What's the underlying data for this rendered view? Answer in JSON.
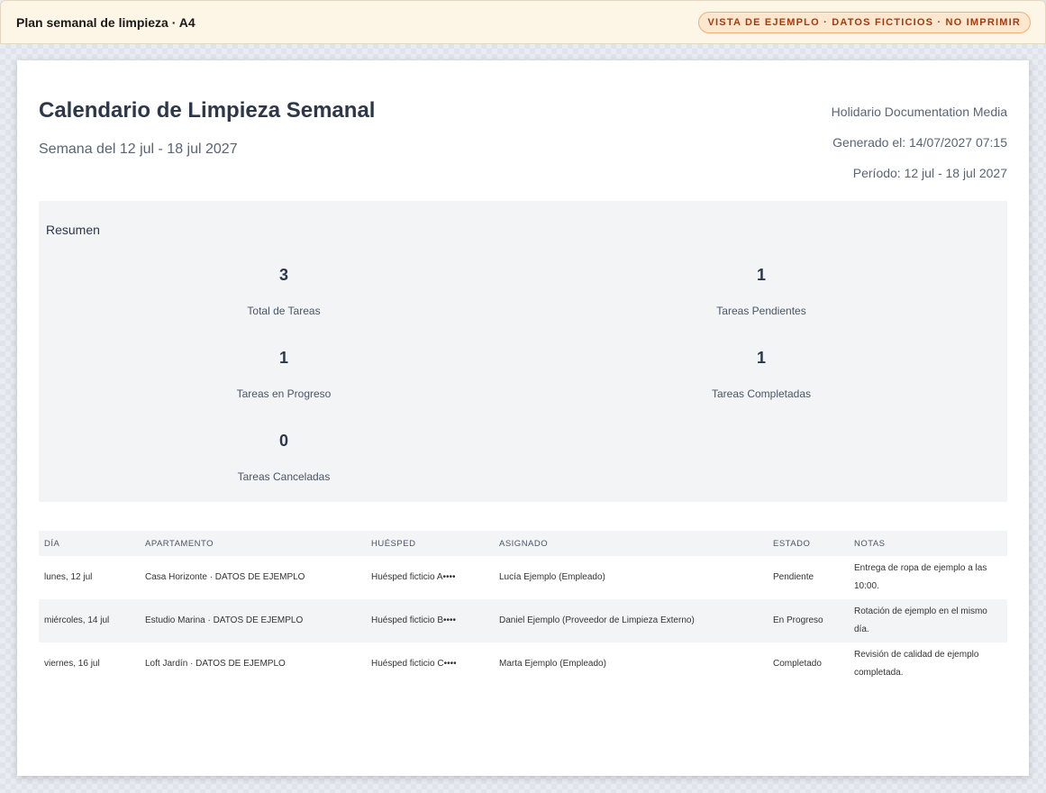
{
  "topbar": {
    "title": "Plan semanal de limpieza · A4",
    "badge": "VISTA DE EJEMPLO · DATOS FICTICIOS · NO IMPRIMIR"
  },
  "report": {
    "title": "Calendario de Limpieza Semanal",
    "subtitle": "Semana del 12 jul - 18 jul 2027",
    "company": "Holidario Documentation Media",
    "generated": "Generado el: 14/07/2027 07:15",
    "period": "Período: 12 jul - 18 jul 2027"
  },
  "summary": {
    "title": "Resumen",
    "stats": [
      {
        "value": "3",
        "label": "Total de Tareas"
      },
      {
        "value": "1",
        "label": "Tareas Pendientes"
      },
      {
        "value": "1",
        "label": "Tareas en Progreso"
      },
      {
        "value": "1",
        "label": "Tareas Completadas"
      },
      {
        "value": "0",
        "label": "Tareas Canceladas"
      }
    ]
  },
  "table": {
    "headers": [
      "DÍA",
      "APARTAMENTO",
      "HUÉSPED",
      "ASIGNADO",
      "ESTADO",
      "NOTAS"
    ],
    "rows": [
      [
        "lunes, 12 jul",
        "Casa Horizonte · DATOS DE EJEMPLO",
        "Huésped ficticio A••••",
        "Lucía Ejemplo (Empleado)",
        "Pendiente",
        "Entrega de ropa de ejemplo a las 10:00."
      ],
      [
        "miércoles, 14 jul",
        "Estudio Marina · DATOS DE EJEMPLO",
        "Huésped ficticio B••••",
        "Daniel Ejemplo (Proveedor de Limpieza Externo)",
        "En Progreso",
        "Rotación de ejemplo en el mismo día."
      ],
      [
        "viernes, 16 jul",
        "Loft Jardín · DATOS DE EJEMPLO",
        "Huésped ficticio C••••",
        "Marta Ejemplo (Empleado)",
        "Completado",
        "Revisión de calidad de ejemplo completada."
      ]
    ]
  }
}
